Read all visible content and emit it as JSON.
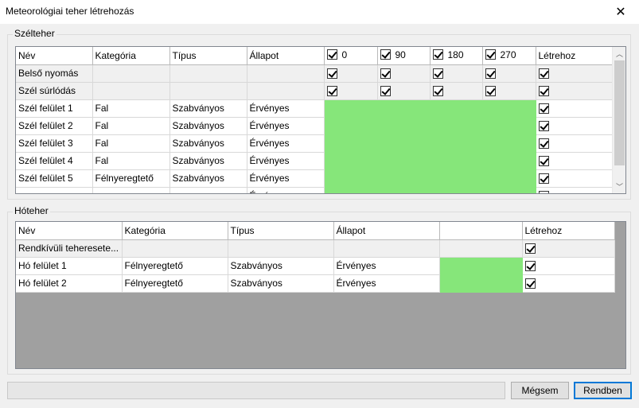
{
  "window": {
    "title": "Meteorológiai teher létrehozás",
    "close_glyph": "✕"
  },
  "wind": {
    "group_label": "Szélteher",
    "headers": {
      "name": "Név",
      "category": "Kategória",
      "type": "Típus",
      "status": "Állapot",
      "dir0": "0",
      "dir90": "90",
      "dir180": "180",
      "dir270": "270",
      "create": "Létrehoz"
    },
    "header_checks": {
      "dir0": true,
      "dir90": true,
      "dir180": true,
      "dir270": true
    },
    "rows": [
      {
        "name": "Belső nyomás",
        "category": "",
        "type": "",
        "status": "",
        "kind": "check",
        "dirs": [
          true,
          true,
          true,
          true
        ],
        "create": true
      },
      {
        "name": "Szél súrlódás",
        "category": "",
        "type": "",
        "status": "",
        "kind": "check",
        "dirs": [
          true,
          true,
          true,
          true
        ],
        "create": true
      },
      {
        "name": "Szél felület 1",
        "category": "Fal",
        "type": "Szabványos",
        "status": "Érvényes",
        "kind": "green",
        "create": true
      },
      {
        "name": "Szél felület 2",
        "category": "Fal",
        "type": "Szabványos",
        "status": "Érvényes",
        "kind": "green",
        "create": true
      },
      {
        "name": "Szél felület 3",
        "category": "Fal",
        "type": "Szabványos",
        "status": "Érvényes",
        "kind": "green",
        "create": true
      },
      {
        "name": "Szél felület 4",
        "category": "Fal",
        "type": "Szabványos",
        "status": "Érvényes",
        "kind": "green",
        "create": true
      },
      {
        "name": "Szél felület 5",
        "category": "Félnyeregtető",
        "type": "Szabványos",
        "status": "Érvényes",
        "kind": "green",
        "create": true
      },
      {
        "name": "",
        "category": "",
        "type": "",
        "status": "Érvényes",
        "kind": "green",
        "create": true
      }
    ]
  },
  "snow": {
    "group_label": "Hóteher",
    "headers": {
      "name": "Név",
      "category": "Kategória",
      "type": "Típus",
      "status": "Állapot",
      "blank": "",
      "create": "Létrehoz"
    },
    "rows": [
      {
        "name": "Rendkívüli teheresete...",
        "category": "",
        "type": "",
        "status": "",
        "kind": "ro",
        "create": true
      },
      {
        "name": "Hó felület 1",
        "category": "Félnyeregtető",
        "type": "Szabványos",
        "status": "Érvényes",
        "kind": "green",
        "create": true
      },
      {
        "name": "Hó felület 2",
        "category": "Félnyeregtető",
        "type": "Szabványos",
        "status": "Érvényes",
        "kind": "green",
        "create": true
      }
    ]
  },
  "buttons": {
    "cancel": "Mégsem",
    "ok": "Rendben"
  },
  "colors": {
    "valid_cell": "#86e67a",
    "empty_grid": "#a0a0a0",
    "accent": "#0078d7"
  },
  "icons": {
    "close": "close-icon",
    "scroll_up": "chevron-up-icon",
    "scroll_down": "chevron-down-icon",
    "checkbox": "checkbox-icon"
  }
}
